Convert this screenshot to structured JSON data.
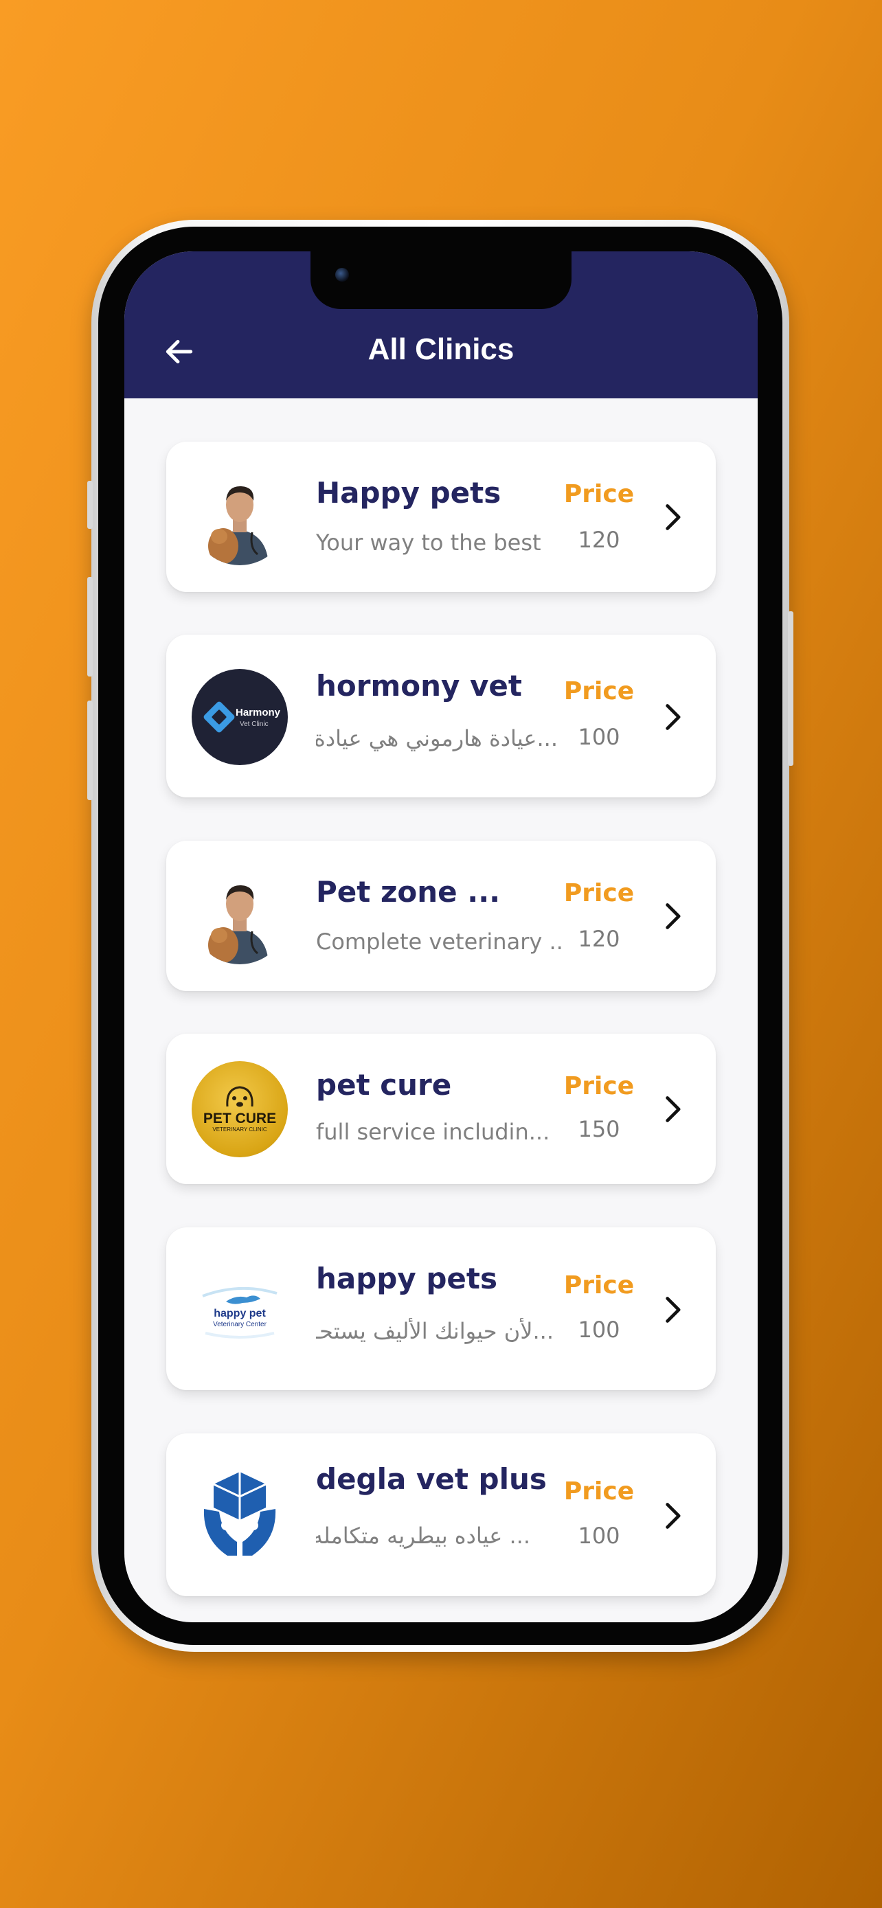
{
  "header": {
    "title": "All Clinics",
    "back_icon": "arrow-left-icon"
  },
  "colors": {
    "appbar": "#242560",
    "price": "#f19b1f",
    "name": "#242560",
    "background_orange": "#f99c24"
  },
  "clinics": [
    {
      "name": "Happy pets",
      "description": "Your way to the best",
      "price_label": "Price",
      "price": "120",
      "icon": "vet-with-dog-photo"
    },
    {
      "name": "hormony vet",
      "description": "...عيادة هارموني هي عيادة",
      "price_label": "Price",
      "price": "100",
      "icon": "harmony-vet-clinic-logo",
      "logo_text": "Harmony",
      "logo_subtext": "Vet Clinic"
    },
    {
      "name": "Pet zone ...",
      "description": "Complete veterinary ...",
      "price_label": "Price",
      "price": "120",
      "icon": "vet-with-dog-photo"
    },
    {
      "name": "pet cure",
      "description": "full service includin...",
      "price_label": "Price",
      "price": "150",
      "icon": "pet-cure-logo",
      "logo_text": "PET CURE",
      "logo_subtext": "VETERINARY CLINIC"
    },
    {
      "name": "happy pets",
      "description": "...لأن حيوانك الأليف يستحـ",
      "price_label": "Price",
      "price": "100",
      "icon": "happy-pet-logo",
      "logo_text": "happy pet",
      "logo_subtext": "Veterinary Center"
    },
    {
      "name": "degla vet plus",
      "description": "... عياده بيطريه متكامله",
      "price_label": "Price",
      "price": "100",
      "icon": "degla-vet-logo"
    }
  ]
}
